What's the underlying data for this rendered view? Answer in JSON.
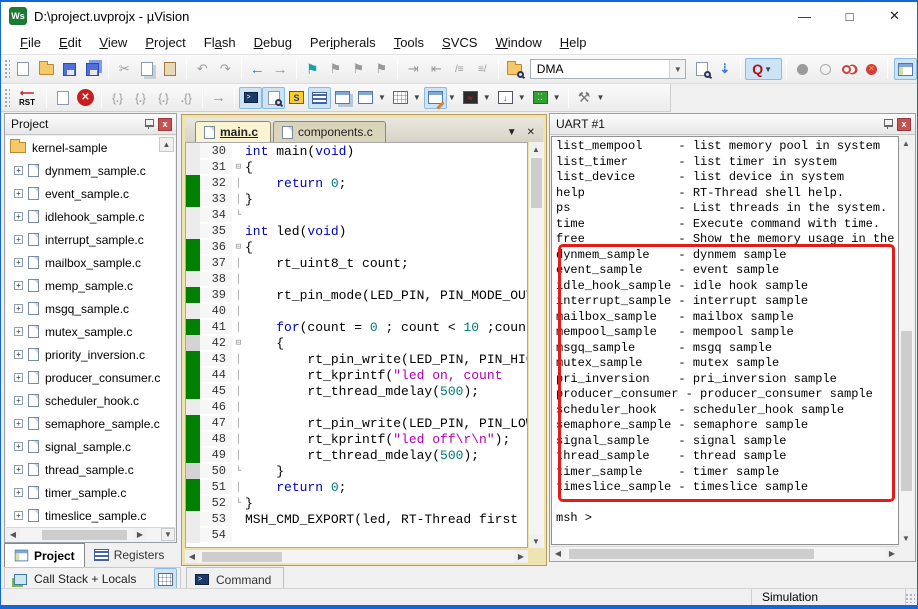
{
  "window": {
    "title": "D:\\project.uvprojx - µVision",
    "app_icon": "Ws",
    "controls": {
      "minimize": "—",
      "maximize": "□",
      "close": "✕"
    }
  },
  "menus": [
    {
      "label": "File",
      "u": 0
    },
    {
      "label": "Edit",
      "u": 0
    },
    {
      "label": "View",
      "u": 0
    },
    {
      "label": "Project",
      "u": 0
    },
    {
      "label": "Flash",
      "u": 2
    },
    {
      "label": "Debug",
      "u": 0
    },
    {
      "label": "Peripherals",
      "u": 3
    },
    {
      "label": "Tools",
      "u": 0
    },
    {
      "label": "SVCS",
      "u": 0
    },
    {
      "label": "Window",
      "u": 0
    },
    {
      "label": "Help",
      "u": 0
    }
  ],
  "toolbar": {
    "dma_value": "DMA",
    "rst_label": "RST",
    "search_q": "Q"
  },
  "project_panel": {
    "title": "Project",
    "root": "kernel-sample",
    "items": [
      "dynmem_sample.c",
      "event_sample.c",
      "idlehook_sample.c",
      "interrupt_sample.c",
      "mailbox_sample.c",
      "memp_sample.c",
      "msgq_sample.c",
      "mutex_sample.c",
      "priority_inversion.c",
      "producer_consumer.c",
      "scheduler_hook.c",
      "semaphore_sample.c",
      "signal_sample.c",
      "thread_sample.c",
      "timer_sample.c",
      "timeslice_sample.c"
    ]
  },
  "editor": {
    "tabs": [
      {
        "label": "main.c",
        "active": true
      },
      {
        "label": "components.c",
        "active": false
      }
    ],
    "lines": [
      {
        "n": 30,
        "e": "",
        "f": "",
        "t": [
          [
            "k",
            "int"
          ],
          [
            "p",
            " main("
          ],
          [
            "k",
            "void"
          ],
          [
            "p",
            ")"
          ]
        ]
      },
      {
        "n": 31,
        "e": "",
        "f": "+",
        "t": [
          [
            "p",
            "{"
          ]
        ]
      },
      {
        "n": 32,
        "e": "g",
        "f": "|",
        "t": [
          [
            "p",
            "    "
          ],
          [
            "k",
            "return"
          ],
          [
            "p",
            " "
          ],
          [
            "n",
            "0"
          ],
          [
            "p",
            ";"
          ]
        ]
      },
      {
        "n": 33,
        "e": "g",
        "f": "|",
        "t": [
          [
            "p",
            "}"
          ]
        ]
      },
      {
        "n": 34,
        "e": "",
        "f": "L",
        "t": []
      },
      {
        "n": 35,
        "e": "",
        "f": "",
        "t": [
          [
            "k",
            "int"
          ],
          [
            "p",
            " led("
          ],
          [
            "k",
            "void"
          ],
          [
            "p",
            ")"
          ]
        ]
      },
      {
        "n": 36,
        "e": "g",
        "f": "+",
        "t": [
          [
            "p",
            "{"
          ]
        ]
      },
      {
        "n": 37,
        "e": "g",
        "f": "|",
        "t": [
          [
            "p",
            "    rt_uint8_t count;"
          ]
        ]
      },
      {
        "n": 38,
        "e": "",
        "f": "|",
        "t": []
      },
      {
        "n": 39,
        "e": "g",
        "f": "|",
        "t": [
          [
            "p",
            "    rt_pin_mode(LED_PIN, PIN_MODE_OUTPUT);"
          ]
        ]
      },
      {
        "n": 40,
        "e": "",
        "f": "|",
        "t": []
      },
      {
        "n": 41,
        "e": "g",
        "f": "|",
        "t": [
          [
            "p",
            "    "
          ],
          [
            "k",
            "for"
          ],
          [
            "p",
            "(count = "
          ],
          [
            "n",
            "0"
          ],
          [
            "p",
            " ; count < "
          ],
          [
            "n",
            "10"
          ],
          [
            "p",
            " ;count++)"
          ]
        ]
      },
      {
        "n": 42,
        "e": "y",
        "f": "+",
        "t": [
          [
            "p",
            "    {"
          ]
        ]
      },
      {
        "n": 43,
        "e": "g",
        "f": "|",
        "t": [
          [
            "p",
            "        rt_pin_write(LED_PIN, PIN_HIGH);"
          ]
        ]
      },
      {
        "n": 44,
        "e": "g",
        "f": "|",
        "t": [
          [
            "p",
            "        rt_kprintf("
          ],
          [
            "s",
            "\"led on, count"
          ]
        ]
      },
      {
        "n": 45,
        "e": "g",
        "f": "|",
        "t": [
          [
            "p",
            "        rt_thread_mdelay("
          ],
          [
            "n",
            "500"
          ],
          [
            "p",
            ");"
          ]
        ]
      },
      {
        "n": 46,
        "e": "",
        "f": "|",
        "t": []
      },
      {
        "n": 47,
        "e": "g",
        "f": "|",
        "t": [
          [
            "p",
            "        rt_pin_write(LED_PIN, PIN_LOW);"
          ]
        ]
      },
      {
        "n": 48,
        "e": "g",
        "f": "|",
        "t": [
          [
            "p",
            "        rt_kprintf("
          ],
          [
            "s",
            "\"led off\\r\\n\""
          ],
          [
            "p",
            ");"
          ]
        ]
      },
      {
        "n": 49,
        "e": "g",
        "f": "|",
        "t": [
          [
            "p",
            "        rt_thread_mdelay("
          ],
          [
            "n",
            "500"
          ],
          [
            "p",
            ");"
          ]
        ]
      },
      {
        "n": 50,
        "e": "y",
        "f": "L",
        "t": [
          [
            "p",
            "    }"
          ]
        ]
      },
      {
        "n": 51,
        "e": "g",
        "f": "|",
        "t": [
          [
            "p",
            "    "
          ],
          [
            "k",
            "return"
          ],
          [
            "p",
            " "
          ],
          [
            "n",
            "0"
          ],
          [
            "p",
            ";"
          ]
        ]
      },
      {
        "n": 52,
        "e": "g",
        "f": "L",
        "t": [
          [
            "p",
            "}"
          ]
        ]
      },
      {
        "n": 53,
        "e": "",
        "f": "",
        "t": [
          [
            "p",
            "MSH_CMD_EXPORT(led, RT-Thread first led);"
          ]
        ]
      },
      {
        "n": 54,
        "e": "",
        "f": "",
        "t": []
      }
    ]
  },
  "uart_panel": {
    "title": "UART #1",
    "lines": [
      "list_mempool     - list memory pool in system",
      "list_timer       - list timer in system",
      "list_device      - list device in system",
      "help             - RT-Thread shell help.",
      "ps               - List threads in the system.",
      "time             - Execute command with time.",
      "free             - Show the memory usage in the system.",
      "dynmem_sample    - dynmem sample",
      "event_sample     - event sample",
      "idle_hook_sample - idle hook sample",
      "interrupt_sample - interrupt sample",
      "mailbox_sample   - mailbox sample",
      "mempool_sample   - mempool sample",
      "msgq_sample      - msgq sample",
      "mutex_sample     - mutex sample",
      "pri_inversion    - pri_inversion sample",
      "producer_consumer - producer_consumer sample",
      "scheduler_hook   - scheduler_hook sample",
      "semaphore_sample - semaphore sample",
      "signal_sample    - signal sample",
      "thread_sample    - thread sample",
      "timer_sample     - timer sample",
      "timeslice_sample - timeslice sample",
      "",
      "msh >"
    ],
    "highlight_start_line": 7,
    "highlight_end_line": 22
  },
  "bottom": {
    "tabs": [
      {
        "label": "Project",
        "active": true
      },
      {
        "label": "Registers",
        "active": false
      }
    ],
    "callstack_label": "Call Stack + Locals",
    "command_tab_label": "Command"
  },
  "statusbar": {
    "mode": "Simulation"
  },
  "colors": {
    "accent_border": "#1266d8",
    "exec_green": "#008000",
    "exec_gray": "#d4d4d4",
    "highlight_red": "#e41b17",
    "syntax_keyword": "#0000c8",
    "syntax_number": "#007878",
    "syntax_string": "#b400b4",
    "syntax_plain": "#000000"
  }
}
